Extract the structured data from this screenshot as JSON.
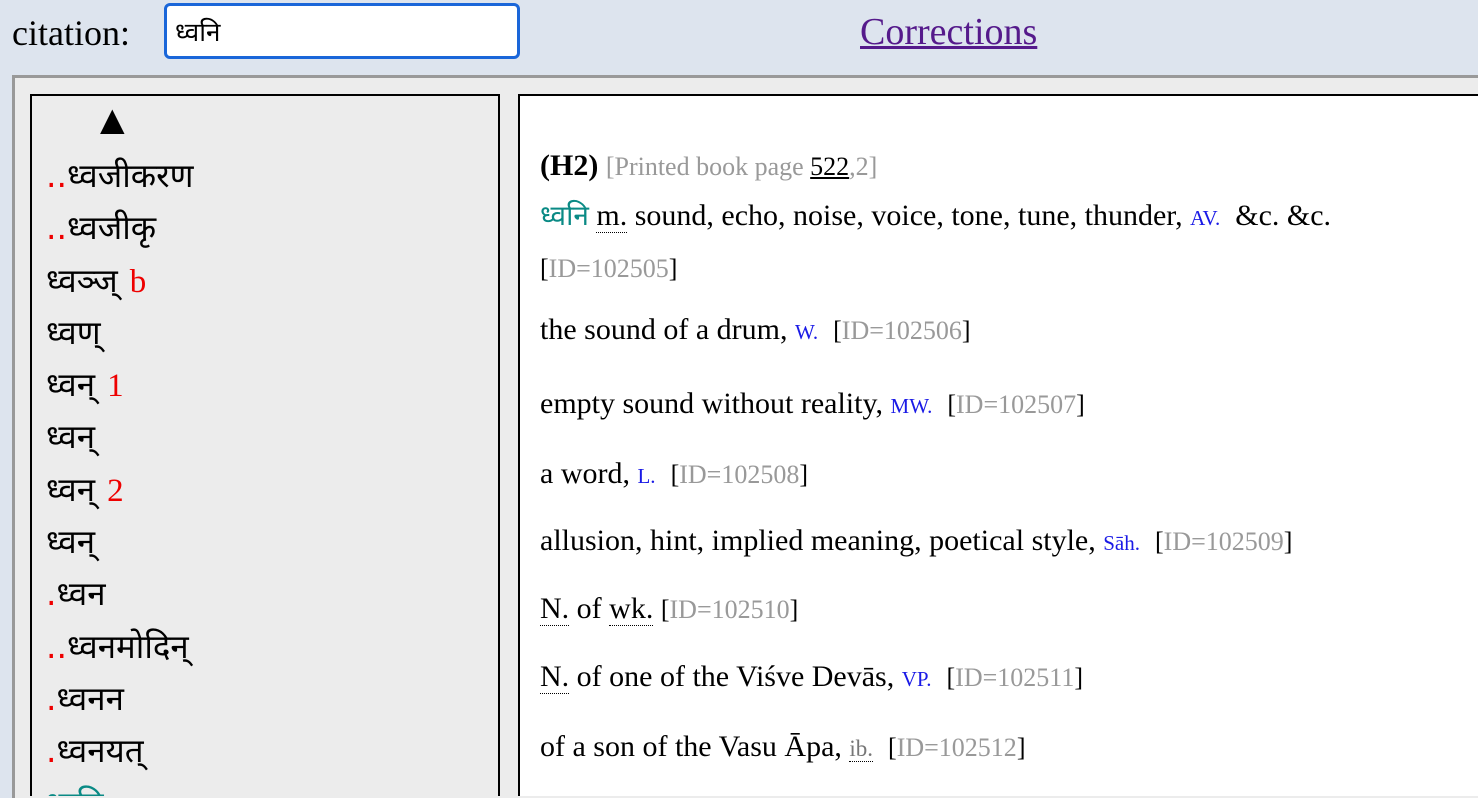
{
  "search": {
    "label": "citation:",
    "value": "ध्वनि"
  },
  "header": {
    "corrections_link": "Corrections"
  },
  "nav": {
    "up_arrow": "▲"
  },
  "list_items": [
    {
      "dots": "..",
      "text": "ध्वजीकरण",
      "tag": ""
    },
    {
      "dots": "..",
      "text": "ध्वजीकृ",
      "tag": ""
    },
    {
      "dots": "",
      "text": "ध्वञ्ज्",
      "tag": "b"
    },
    {
      "dots": "",
      "text": "ध्वण्",
      "tag": ""
    },
    {
      "dots": "",
      "text": "ध्वन्",
      "tag": "1"
    },
    {
      "dots": "",
      "text": "ध्वन्",
      "tag": ""
    },
    {
      "dots": "",
      "text": "ध्वन्",
      "tag": "2"
    },
    {
      "dots": "",
      "text": "ध्वन्",
      "tag": ""
    },
    {
      "dots": ".",
      "text": "ध्वन",
      "tag": ""
    },
    {
      "dots": "..",
      "text": "ध्वनमोदिन्",
      "tag": ""
    },
    {
      "dots": ".",
      "text": "ध्वनन",
      "tag": ""
    },
    {
      "dots": ".",
      "text": "ध्वनयत्",
      "tag": ""
    },
    {
      "dots": "",
      "text": "ध्वनि",
      "tag": ""
    }
  ],
  "entry": {
    "hcode": "(H2)",
    "page_prefix": "[Printed book page ",
    "page_num": "522",
    "page_suffix": ",2]",
    "headword": "ध्वनि",
    "gender": "m.",
    "def1": " sound, echo, noise, voice, tone, tune, thunder,",
    "src1": "AV.",
    "def1_tail": "&c. &c.",
    "id1": "ID=102505",
    "def2": "the sound of a drum,",
    "src2": "W.",
    "id2": "ID=102506",
    "def3": "empty sound without reality,",
    "src3": "MW.",
    "id3": "ID=102507",
    "def4": "a word,",
    "src4": "L.",
    "id4": "ID=102508",
    "def5": "allusion, hint, implied meaning, poetical style,",
    "src5": "Sāh.",
    "id5": "ID=102509",
    "def6_n": "N.",
    "def6_mid": " of ",
    "def6_wk": "wk.",
    "id6": "ID=102510",
    "def7_n": "N.",
    "def7": " of one of the Viśve Devās,",
    "src7": "VP.",
    "id7": "ID=102511",
    "def8": "of a son of the Vasu Āpa,",
    "src8": "ib.",
    "id8": "ID=102512"
  },
  "colors": {
    "accent_red": "#e00000",
    "teal": "#0a8a85",
    "link_blue": "#1a1ae6",
    "visited": "#551a8b"
  }
}
